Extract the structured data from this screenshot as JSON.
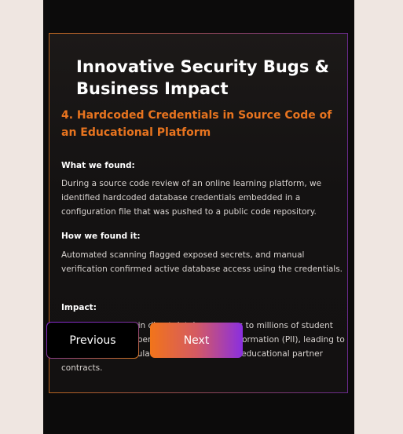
{
  "card": {
    "title": "Innovative Security Bugs & Business Impact",
    "subtitle": "4. Hardcoded Credentials in Source Code of an Educational Platform",
    "sections": [
      {
        "label": "What we found:",
        "text": "During a source code review of an online learning platform, we identified hardcoded database credentials embedded in a configuration file that was pushed to a public code repository."
      },
      {
        "label": "How we found it:",
        "text": "Automated scanning flagged exposed secrets, and manual verification confirmed active database access using the credentials."
      },
      {
        "label": "Impact:",
        "text": "Attackers could gain direct database access to millions of student records, including personally identifiable information (PII), leading to a data breach, regulatory fines, and loss of educational partner contracts."
      }
    ]
  },
  "nav": {
    "previous_label": "Previous",
    "next_label": "Next"
  },
  "colors": {
    "accent_orange": "#e8741f",
    "accent_purple": "#8a2fe0",
    "background": "#0c0b0b"
  }
}
